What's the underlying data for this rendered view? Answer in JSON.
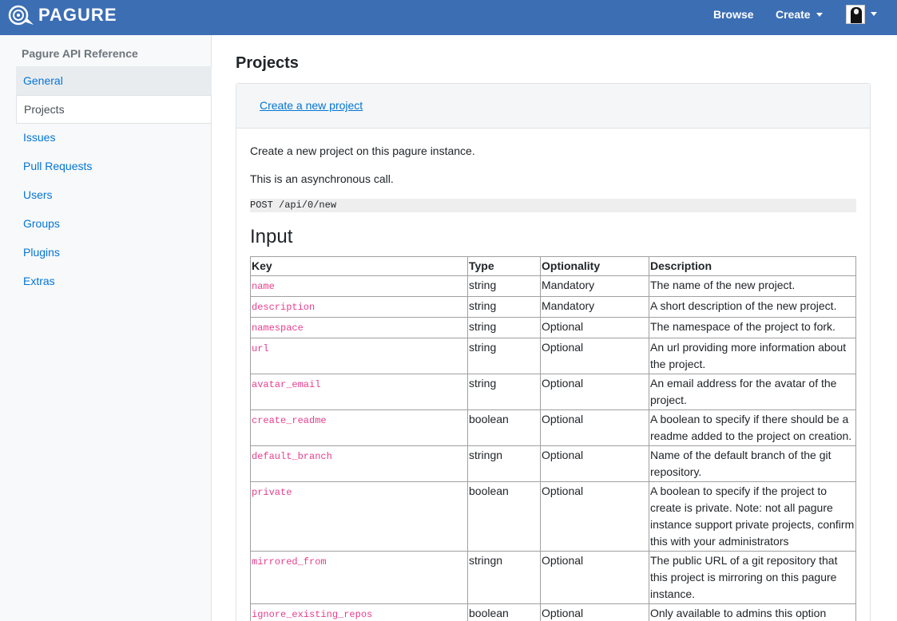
{
  "nav": {
    "brand": "PAGURE",
    "browse": "Browse",
    "create": "Create"
  },
  "sidebar": {
    "title": "Pagure API Reference",
    "items": [
      {
        "label": "General"
      },
      {
        "label": "Projects"
      },
      {
        "label": "Issues"
      },
      {
        "label": "Pull Requests"
      },
      {
        "label": "Users"
      },
      {
        "label": "Groups"
      },
      {
        "label": "Plugins"
      },
      {
        "label": "Extras"
      }
    ]
  },
  "main": {
    "title": "Projects",
    "card_link": "Create a new project",
    "para1": "Create a new project on this pagure instance.",
    "para2": "This is an asynchronous call.",
    "endpoint": "POST /api/0/new",
    "input_heading": "Input",
    "table": {
      "headers": [
        "Key",
        "Type",
        "Optionality",
        "Description"
      ],
      "rows": [
        {
          "key": "name",
          "type": "string",
          "opt": "Mandatory",
          "desc": "The name of the new project."
        },
        {
          "key": "description",
          "type": "string",
          "opt": "Mandatory",
          "desc": "A short description of the new project."
        },
        {
          "key": "namespace",
          "type": "string",
          "opt": "Optional",
          "desc": "The namespace of the project to fork."
        },
        {
          "key": "url",
          "type": "string",
          "opt": "Optional",
          "desc": "An url providing more information about the project."
        },
        {
          "key": "avatar_email",
          "type": "string",
          "opt": "Optional",
          "desc": "An email address for the avatar of the project."
        },
        {
          "key": "create_readme",
          "type": "boolean",
          "opt": "Optional",
          "desc": "A boolean to specify if there should be a readme added to the project on creation."
        },
        {
          "key": "default_branch",
          "type": "stringn",
          "opt": "Optional",
          "desc": "Name of the default branch of the git repository."
        },
        {
          "key": "private",
          "type": "boolean",
          "opt": "Optional",
          "desc": "A boolean to specify if the project to create is private. Note: not all pagure instance support private projects, confirm this with your administrators"
        },
        {
          "key": "mirrored_from",
          "type": "stringn",
          "opt": "Optional",
          "desc": "The public URL of a git repository that this project is mirroring on this pagure instance."
        },
        {
          "key": "ignore_existing_repos",
          "type": "boolean",
          "opt": "Optional",
          "desc": "Only available to admins this option allows them to make project creation"
        }
      ]
    }
  },
  "colors": {
    "navbar": "#3c6eb4",
    "link": "#0275d8",
    "code_key": "#e83e8c"
  }
}
